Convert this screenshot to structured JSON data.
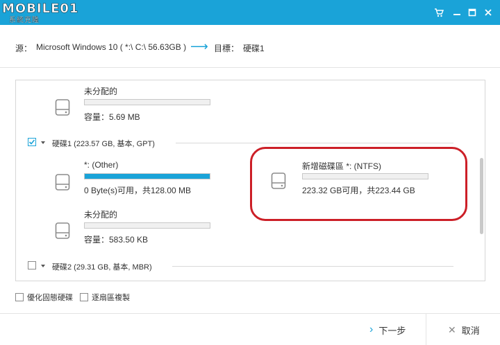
{
  "app": {
    "logo_text": "MOBILE01",
    "logo_subtitle": "系統克隆"
  },
  "window_controls": [
    "cart-icon",
    "minimize-icon",
    "maximize-icon",
    "close-icon"
  ],
  "source": {
    "source_label": "源：",
    "source_value": "Microsoft Windows 10 ( *:\\ C:\\  56.63GB )",
    "arrow": "⟶",
    "target_label": "目標：",
    "target_value": "硬碟1"
  },
  "disk0": {
    "partition_unalloc": {
      "name": "未分配的",
      "info": "容量：5.69 MB",
      "used_fraction": 0
    }
  },
  "disk1": {
    "checked": true,
    "title": "硬碟1 (223.57 GB, 基本, GPT)",
    "partitions": [
      {
        "name": "*: (Other)",
        "info": "0 Byte(s)可用，共128.00 MB",
        "used_fraction": 1.0
      },
      {
        "name": "新增磁碟區 *: (NTFS)",
        "info": "223.32 GB可用，共223.44 GB",
        "used_fraction": 0.0
      },
      {
        "name": "未分配的",
        "info": "容量：583.50 KB",
        "used_fraction": 0
      }
    ]
  },
  "disk2": {
    "checked": false,
    "title": "硬碟2 (29.31 GB, 基本, MBR)"
  },
  "options": {
    "optimize_ssd": "優化固態硬碟",
    "sector_copy": "逐扇區複製"
  },
  "footer": {
    "next_label": "下一步",
    "cancel_label": "取消"
  },
  "colors": {
    "accent": "#1aa3d8",
    "highlight": "#cc1f27"
  }
}
